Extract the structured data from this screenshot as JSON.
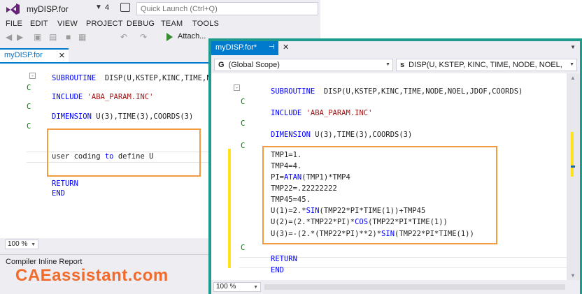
{
  "back_window": {
    "title": "myDISP.for",
    "notification_count": "4",
    "quick_launch_placeholder": "Quick Launch (Ctrl+Q)",
    "menu": [
      "FILE",
      "EDIT",
      "VIEW",
      "PROJECT",
      "DEBUG",
      "TEAM",
      "TOOLS"
    ],
    "toolbar": {
      "attach_label": "Attach..."
    },
    "tab": {
      "label": "myDISP.for",
      "close": "✕"
    },
    "code": {
      "subroutine_kw": "SUBROUTINE",
      "subroutine_rest": "  DISP(U,KSTEP,KINC,TIME,NODE,",
      "comment_marker": "C",
      "include_kw": "INCLUDE",
      "include_str": "'ABA_PARAM.INC'",
      "dimension_kw": "DIMENSION",
      "dimension_rest": " U(3),TIME(3),COORDS(3)",
      "user_line_1": "user coding ",
      "user_line_kw": "to",
      "user_line_2": " define U",
      "return_kw": "RETURN",
      "end_kw": "END"
    },
    "zoom": "100 %",
    "compiler_panel_title": "Compiler Inline Report",
    "watermark": "CAEassistant.com"
  },
  "front_window": {
    "tab": {
      "label": "myDISP.for*",
      "pin": "⊣",
      "close": "✕"
    },
    "scope_combo": {
      "icon": "G",
      "value": "(Global Scope)"
    },
    "member_combo": {
      "icon": "s",
      "value": "DISP(U, KSTEP, KINC, TIME, NODE, NOEL,"
    },
    "code": {
      "subroutine_kw": "SUBROUTINE",
      "subroutine_rest": "  DISP(U,KSTEP,KINC,TIME,NODE,NOEL,JDOF,COORDS)",
      "comment_marker": "C",
      "include_kw": "INCLUDE",
      "include_str": "'ABA_PARAM.INC'",
      "dimension_kw": "DIMENSION",
      "dimension_rest": " U(3),TIME(3),COORDS(3)",
      "l1": "TMP1=1.",
      "l2": "TMP4=4.",
      "l3_a": "PI=",
      "l3_kw": "ATAN",
      "l3_b": "(TMP1)*TMP4",
      "l4": "TMP22=.22222222",
      "l5": "TMP45=45.",
      "l6_a": "U(1)=2.*",
      "l6_kw": "SIN",
      "l6_b": "(TMP22*PI*TIME(1))+TMP45",
      "l7_a": "U(2)=(2.*TMP22*PI)*",
      "l7_kw": "COS",
      "l7_b": "(TMP22*PI*TIME(1))",
      "l8_a": "U(3)=-(2.*(TMP22*PI)**2)*",
      "l8_kw": "SIN",
      "l8_b": "(TMP22*PI*TIME(1))",
      "return_kw": "RETURN",
      "end_kw": "END"
    },
    "zoom": "100 %"
  },
  "colors": {
    "keyword": "#0000ff",
    "string": "#a31515",
    "comment": "#008000",
    "highlight_box": "#f19c41",
    "active_tab": "#007acc",
    "window_border": "#1e9b8c",
    "change_bar": "#ffe21a",
    "watermark": "#f26b2a"
  }
}
